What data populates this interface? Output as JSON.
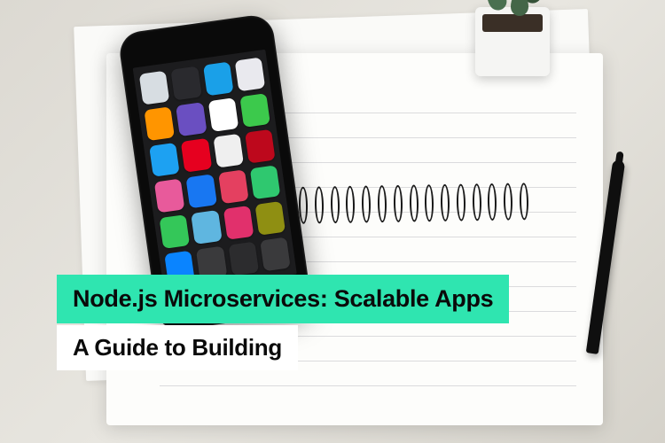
{
  "overlay": {
    "title": "Node.js Microservices: Scalable Apps",
    "subtitle": "A Guide to Building"
  },
  "phone_apps": {
    "grid_rows": 6,
    "grid_cols": 4,
    "colors": [
      "#d7dde2",
      "#2a2a2e",
      "#1aa0e8",
      "#e9e9ee",
      "#ff9500",
      "#6a4fc1",
      "#ffffff",
      "#3cc94c",
      "#1da1f2",
      "#e6001f",
      "#efefef",
      "#bd081c",
      "#e85a9b",
      "#1877f2",
      "#e44060",
      "#2fc86f",
      "#34c759",
      "#5fb6e0",
      "#e1306c",
      "#8f8f12",
      "#0a84ff",
      "#3a3a3c",
      "#2c2c2e",
      "#3a3a3c"
    ]
  },
  "scene": {
    "objects": [
      "spiral notebook open",
      "loose paper sheet",
      "smartphone with app grid",
      "black pen",
      "small potted succulent"
    ],
    "surface": "light wood / off-white desk"
  },
  "colors": {
    "accent": "#2fe5b0",
    "subtitle_bg": "#ffffff",
    "text": "#0a0a0a"
  }
}
